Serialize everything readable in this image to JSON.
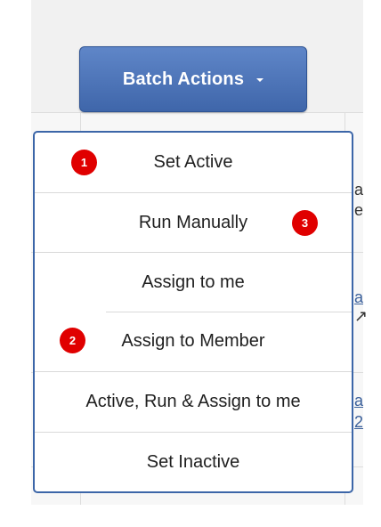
{
  "batch_actions": {
    "label": "Batch Actions",
    "caret_icon": "caret-down-icon"
  },
  "menu": {
    "items": [
      {
        "label": "Set Active"
      },
      {
        "label": "Run Manually"
      },
      {
        "label": "Assign to me"
      },
      {
        "label": "Assign to Member"
      },
      {
        "label": "Active, Run & Assign to me"
      },
      {
        "label": "Set Inactive"
      }
    ]
  },
  "markers": [
    "1",
    "2",
    "3"
  ],
  "background_fragments": [
    "a",
    "e",
    "a",
    "↗",
    "a",
    "2"
  ],
  "colors": {
    "button": "#4a72b8",
    "menu_border": "#3c66a8",
    "marker": "#e00000"
  }
}
